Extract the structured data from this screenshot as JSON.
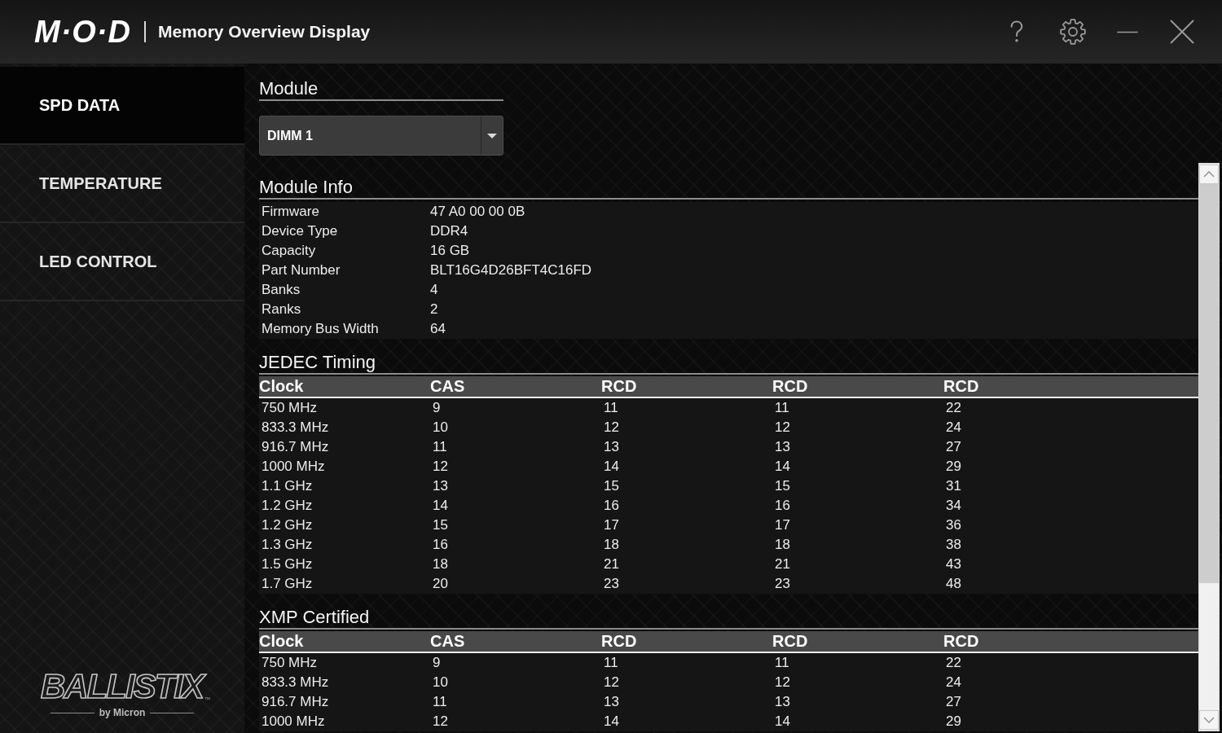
{
  "window": {
    "logo": "M·O·D",
    "title": "Memory Overview Display"
  },
  "sidebar": {
    "items": [
      {
        "label": "SPD DATA",
        "selected": true
      },
      {
        "label": "TEMPERATURE",
        "selected": false
      },
      {
        "label": "LED CONTROL",
        "selected": false
      }
    ],
    "brand": {
      "name": "BALLISTIX",
      "mark": "™",
      "byline": "by Micron"
    }
  },
  "module": {
    "heading": "Module",
    "dropdown": {
      "value": "DIMM 1"
    }
  },
  "module_info": {
    "heading": "Module Info",
    "rows": [
      {
        "label": "Firmware",
        "value": "47 A0 00 00 0B"
      },
      {
        "label": "Device Type",
        "value": "DDR4"
      },
      {
        "label": "Capacity",
        "value": "16 GB"
      },
      {
        "label": "Part Number",
        "value": "BLT16G4D26BFT4C16FD"
      },
      {
        "label": "Banks",
        "value": "4"
      },
      {
        "label": "Ranks",
        "value": "2"
      },
      {
        "label": "Memory Bus Width",
        "value": "64"
      }
    ]
  },
  "jedec_timing": {
    "heading": "JEDEC Timing",
    "columns": [
      "Clock",
      "CAS",
      "RCD",
      "RCD",
      "RCD"
    ],
    "rows": [
      [
        "750 MHz",
        "9",
        "11",
        "11",
        "22"
      ],
      [
        "833.3 MHz",
        "10",
        "12",
        "12",
        "24"
      ],
      [
        "916.7 MHz",
        "11",
        "13",
        "13",
        "27"
      ],
      [
        "1000 MHz",
        "12",
        "14",
        "14",
        "29"
      ],
      [
        "1.1 GHz",
        "13",
        "15",
        "15",
        "31"
      ],
      [
        "1.2 GHz",
        "14",
        "16",
        "16",
        "34"
      ],
      [
        "1.2 GHz",
        "15",
        "17",
        "17",
        "36"
      ],
      [
        "1.3 GHz",
        "16",
        "18",
        "18",
        "38"
      ],
      [
        "1.5 GHz",
        "18",
        "21",
        "21",
        "43"
      ],
      [
        "1.7 GHz",
        "20",
        "23",
        "23",
        "48"
      ]
    ]
  },
  "xmp_certified": {
    "heading": "XMP Certified",
    "columns": [
      "Clock",
      "CAS",
      "RCD",
      "RCD",
      "RCD"
    ],
    "rows": [
      [
        "750 MHz",
        "9",
        "11",
        "11",
        "22"
      ],
      [
        "833.3 MHz",
        "10",
        "12",
        "12",
        "24"
      ],
      [
        "916.7 MHz",
        "11",
        "13",
        "13",
        "27"
      ],
      [
        "1000 MHz",
        "12",
        "14",
        "14",
        "29"
      ]
    ]
  }
}
